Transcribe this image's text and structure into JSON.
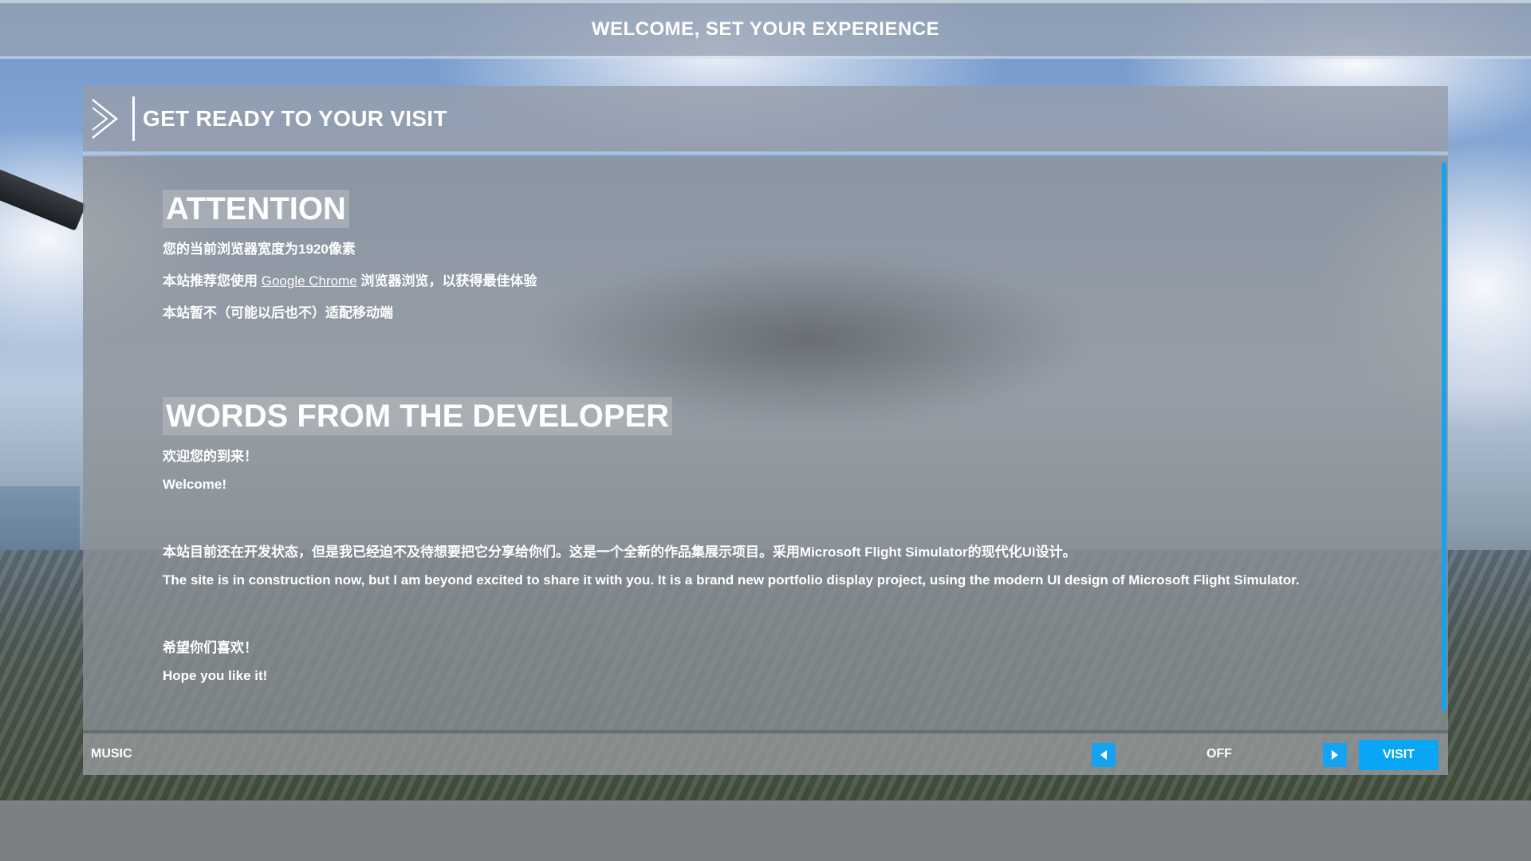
{
  "topbar": {
    "title": "WELCOME, SET YOUR EXPERIENCE"
  },
  "panel": {
    "title": "GET READY TO YOUR VISIT"
  },
  "attention": {
    "heading": "ATTENTION",
    "line1": "您的当前浏览器宽度为1920像素",
    "line2_prefix": "本站推荐您使用",
    "line2_link": "Google Chrome",
    "line2_suffix": "浏览器浏览，以获得最佳体验",
    "line3": "本站暂不（可能以后也不）适配移动端"
  },
  "developer": {
    "heading": "WORDS FROM THE DEVELOPER",
    "greet_cn": "欢迎您的到来！",
    "greet_en": "Welcome!",
    "body_cn": "本站目前还在开发状态，但是我已经迫不及待想要把它分享给你们。这是一个全新的作品集展示项目。采用Microsoft Flight Simulator的现代化UI设计。",
    "body_en": "The site is in construction now, but I am beyond excited to share it with you. It is a brand new portfolio display project, using the modern UI design of Microsoft Flight Simulator.",
    "hope_cn": "希望你们喜欢！",
    "hope_en": "Hope you like it!"
  },
  "footer": {
    "music_label": "MUSIC",
    "music_value": "OFF",
    "visit_label": "VISIT"
  },
  "colors": {
    "accent": "#13a3f0",
    "button": "#08a6f5"
  }
}
